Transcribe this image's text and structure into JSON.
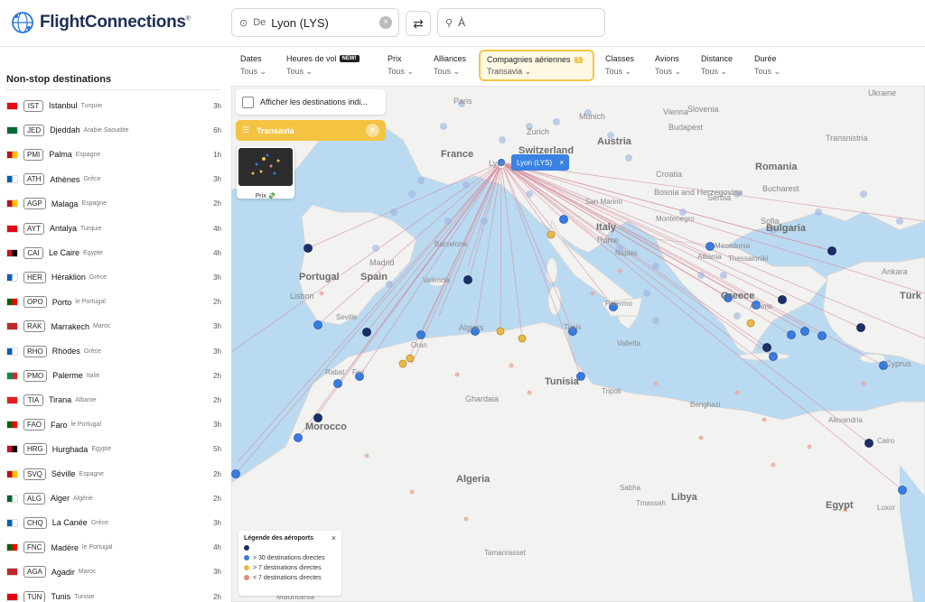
{
  "header": {
    "logo_text": "FlightConnections",
    "logo_mark": "®",
    "from_prefix": "De",
    "from_value": "Lyon (LYS)",
    "to_placeholder": "À",
    "swap_icon": "⇄",
    "clear_icon": "×"
  },
  "filters": [
    {
      "label": "Dates",
      "value": "Tous ⌄"
    },
    {
      "label": "Heures de vol",
      "badge": "NEW!",
      "value": "Tous ⌄"
    },
    {
      "label": "Prix",
      "value": "Tous ⌄"
    },
    {
      "label": "Alliances",
      "value": "Tous ⌄"
    },
    {
      "label": "Compagnies aériennes",
      "count": "1",
      "value": "Transavia ⌄",
      "active": true
    },
    {
      "label": "Classes",
      "value": "Tous ⌄"
    },
    {
      "label": "Avions",
      "value": "Tous ⌄"
    },
    {
      "label": "Distance",
      "value": "Tous ⌄"
    },
    {
      "label": "Durée",
      "value": "Tous ⌄"
    }
  ],
  "sidebar": {
    "title": "Non-stop destinations",
    "items": [
      {
        "code": "IST",
        "city": "Istanbul",
        "country": "Turquie",
        "duration": "3h",
        "flag": [
          "#e30a17",
          "#e30a17"
        ]
      },
      {
        "code": "JED",
        "city": "Djeddah",
        "country": "Arabie Saoudite",
        "duration": "6h",
        "flag": [
          "#006c35",
          "#006c35"
        ]
      },
      {
        "code": "PMI",
        "city": "Palma",
        "country": "Espagne",
        "duration": "1h",
        "flag": [
          "#c60b1e",
          "#ffc400"
        ]
      },
      {
        "code": "ATH",
        "city": "Athènes",
        "country": "Grèce",
        "duration": "3h",
        "flag": [
          "#0d5eaf",
          "#ffffff"
        ]
      },
      {
        "code": "AGP",
        "city": "Malaga",
        "country": "Espagne",
        "duration": "2h",
        "flag": [
          "#c60b1e",
          "#ffc400"
        ]
      },
      {
        "code": "AYT",
        "city": "Antalya",
        "country": "Turquie",
        "duration": "4h",
        "flag": [
          "#e30a17",
          "#e30a17"
        ]
      },
      {
        "code": "CAI",
        "city": "Le Caire",
        "country": "Egypte",
        "duration": "4h",
        "flag": [
          "#ce1126",
          "#000000"
        ]
      },
      {
        "code": "HER",
        "city": "Héraklion",
        "country": "Grèce",
        "duration": "3h",
        "flag": [
          "#0d5eaf",
          "#ffffff"
        ]
      },
      {
        "code": "OPO",
        "city": "Porto",
        "country": "le Portugal",
        "duration": "2h",
        "flag": [
          "#006600",
          "#ff0000"
        ]
      },
      {
        "code": "RAK",
        "city": "Marrakech",
        "country": "Maroc",
        "duration": "3h",
        "flag": [
          "#c1272d",
          "#c1272d"
        ]
      },
      {
        "code": "RHO",
        "city": "Rhodes",
        "country": "Grèce",
        "duration": "3h",
        "flag": [
          "#0d5eaf",
          "#ffffff"
        ]
      },
      {
        "code": "PMO",
        "city": "Palerme",
        "country": "Italie",
        "duration": "2h",
        "flag": [
          "#009246",
          "#ce2b37"
        ]
      },
      {
        "code": "TIA",
        "city": "Tirana",
        "country": "Albanie",
        "duration": "2h",
        "flag": [
          "#e41e20",
          "#e41e20"
        ]
      },
      {
        "code": "FAO",
        "city": "Faro",
        "country": "le Portugal",
        "duration": "3h",
        "flag": [
          "#006600",
          "#ff0000"
        ]
      },
      {
        "code": "HRG",
        "city": "Hurghada",
        "country": "Egypte",
        "duration": "5h",
        "flag": [
          "#ce1126",
          "#000000"
        ]
      },
      {
        "code": "SVQ",
        "city": "Séville",
        "country": "Espagne",
        "duration": "2h",
        "flag": [
          "#c60b1e",
          "#ffc400"
        ]
      },
      {
        "code": "ALG",
        "city": "Alger",
        "country": "Algérie",
        "duration": "2h",
        "flag": [
          "#006633",
          "#ffffff"
        ]
      },
      {
        "code": "CHQ",
        "city": "La Canée",
        "country": "Grèce",
        "duration": "3h",
        "flag": [
          "#0d5eaf",
          "#ffffff"
        ]
      },
      {
        "code": "FNC",
        "city": "Madère",
        "country": "le Portugal",
        "duration": "4h",
        "flag": [
          "#006600",
          "#ff0000"
        ]
      },
      {
        "code": "AGA",
        "city": "Agadir",
        "country": "Maroc",
        "duration": "3h",
        "flag": [
          "#c1272d",
          "#c1272d"
        ]
      },
      {
        "code": "TUN",
        "city": "Tunis",
        "country": "Tunisie",
        "duration": "2h",
        "flag": [
          "#e70013",
          "#e70013"
        ]
      }
    ]
  },
  "map": {
    "show_indirect_label": "Afficher les destinations indi...",
    "airline_chip": "Transavia",
    "price_label": "Prix 💸",
    "origin_popup": "Lyon (LYS)",
    "legend": {
      "title": "Légende des aéroports",
      "items": [
        {
          "label": "",
          "color": "#1c2f6b"
        },
        {
          "label": "> 30 destinations directes",
          "color": "#3a7be0"
        },
        {
          "label": "> 7 destinations directes",
          "color": "#e9b949"
        },
        {
          "label": "< 7 destinations directes",
          "color": "#e58a7c"
        }
      ]
    },
    "labels": [
      {
        "text": "Ukraine"
      },
      {
        "text": "Paris"
      },
      {
        "text": "Munich"
      },
      {
        "text": "Vienna"
      },
      {
        "text": "Zurich"
      },
      {
        "text": "Budapest"
      },
      {
        "text": "France"
      },
      {
        "text": "Switzerland"
      },
      {
        "text": "Austria"
      },
      {
        "text": "Slovenia"
      },
      {
        "text": "Transnistria"
      },
      {
        "text": "Romania"
      },
      {
        "text": "Croatia"
      },
      {
        "text": "Bosnia and Herzegovina"
      },
      {
        "text": "Serbia"
      },
      {
        "text": "Bucharest"
      },
      {
        "text": "Lyon"
      },
      {
        "text": "San Marino"
      },
      {
        "text": "Montenegro"
      },
      {
        "text": "Sofia"
      },
      {
        "text": "Bulgaria"
      },
      {
        "text": "Italy"
      },
      {
        "text": "Rome"
      },
      {
        "text": "Macedonia"
      },
      {
        "text": "Albania"
      },
      {
        "text": "Thessaloniki"
      },
      {
        "text": "Portugal"
      },
      {
        "text": "Madrid"
      },
      {
        "text": "Spain"
      },
      {
        "text": "Barcelona"
      },
      {
        "text": "Valencia"
      },
      {
        "text": "Naples"
      },
      {
        "text": "Ankara"
      },
      {
        "text": "Türk"
      },
      {
        "text": "Lisbon"
      },
      {
        "text": "Palermo"
      },
      {
        "text": "Greece"
      },
      {
        "text": "Athens"
      },
      {
        "text": "Seville"
      },
      {
        "text": "Algiers"
      },
      {
        "text": "Tunis"
      },
      {
        "text": "Valletta"
      },
      {
        "text": "Cyprus"
      },
      {
        "text": "Oran"
      },
      {
        "text": "Rabat"
      },
      {
        "text": "Fez"
      },
      {
        "text": "Tunisia"
      },
      {
        "text": "Tripoli"
      },
      {
        "text": "Morocco"
      },
      {
        "text": "Ghardaia"
      },
      {
        "text": "Benghazi"
      },
      {
        "text": "Alexandria"
      },
      {
        "text": "Cairo"
      },
      {
        "text": "Algeria"
      },
      {
        "text": "Sabha"
      },
      {
        "text": "Tmassah"
      },
      {
        "text": "Libya"
      },
      {
        "text": "Egypt"
      },
      {
        "text": "Luxor"
      },
      {
        "text": "Tamanrasset"
      },
      {
        "text": "Mauritania"
      }
    ]
  }
}
